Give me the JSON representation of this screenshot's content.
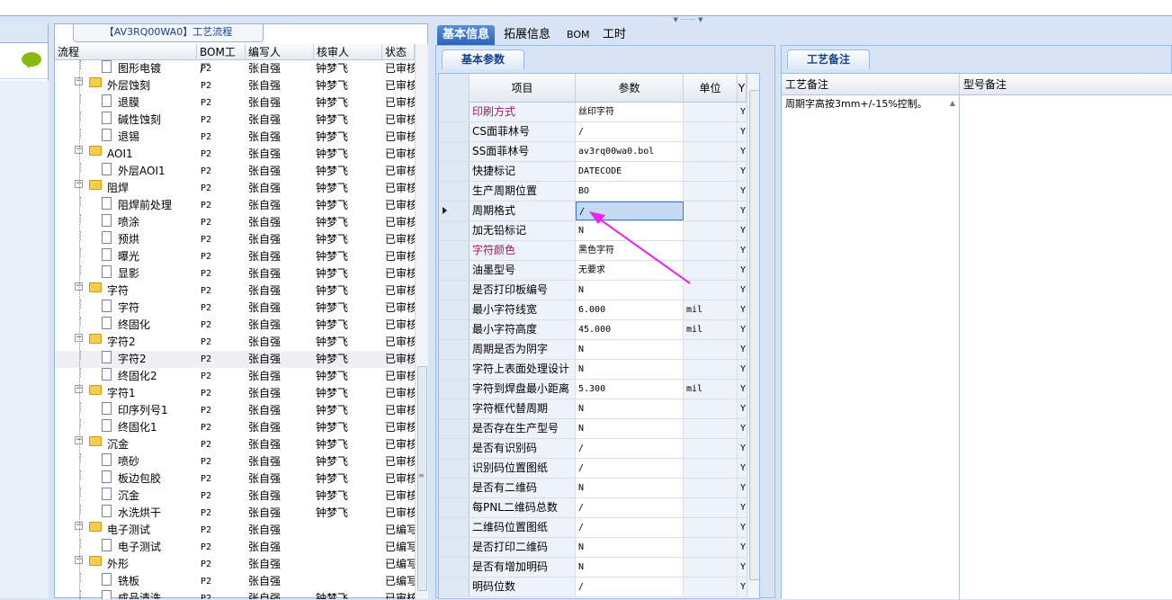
{
  "tree": {
    "title": "【AV3RQ00WA0】工艺流程",
    "columns": [
      "流程",
      "BOM工厂",
      "编写人",
      "核审人",
      "状态"
    ],
    "rows": [
      {
        "depth": 2,
        "type": "doc",
        "name": "图形电镀",
        "bom": "P2",
        "writer": "张自强",
        "reviewer": "钟梦飞",
        "status": "已审核"
      },
      {
        "depth": 1,
        "type": "folder",
        "name": "外层蚀刻",
        "bom": "P2",
        "writer": "张自强",
        "reviewer": "钟梦飞",
        "status": "已审核"
      },
      {
        "depth": 2,
        "type": "doc",
        "name": "退膜",
        "bom": "P2",
        "writer": "张自强",
        "reviewer": "钟梦飞",
        "status": "已审核"
      },
      {
        "depth": 2,
        "type": "doc",
        "name": "碱性蚀刻",
        "bom": "P2",
        "writer": "张自强",
        "reviewer": "钟梦飞",
        "status": "已审核"
      },
      {
        "depth": 2,
        "type": "doc",
        "name": "退锡",
        "bom": "P2",
        "writer": "张自强",
        "reviewer": "钟梦飞",
        "status": "已审核"
      },
      {
        "depth": 1,
        "type": "folder",
        "name": "AOI1",
        "bom": "P2",
        "writer": "张自强",
        "reviewer": "钟梦飞",
        "status": "已审核"
      },
      {
        "depth": 2,
        "type": "doc",
        "name": "外层AOI1",
        "bom": "P2",
        "writer": "张自强",
        "reviewer": "钟梦飞",
        "status": "已审核"
      },
      {
        "depth": 1,
        "type": "folder",
        "name": "阻焊",
        "bom": "P2",
        "writer": "张自强",
        "reviewer": "钟梦飞",
        "status": "已审核"
      },
      {
        "depth": 2,
        "type": "doc",
        "name": "阻焊前处理",
        "bom": "P2",
        "writer": "张自强",
        "reviewer": "钟梦飞",
        "status": "已审核"
      },
      {
        "depth": 2,
        "type": "doc",
        "name": "喷涂",
        "bom": "P2",
        "writer": "张自强",
        "reviewer": "钟梦飞",
        "status": "已审核"
      },
      {
        "depth": 2,
        "type": "doc",
        "name": "预烘",
        "bom": "P2",
        "writer": "张自强",
        "reviewer": "钟梦飞",
        "status": "已审核"
      },
      {
        "depth": 2,
        "type": "doc",
        "name": "曝光",
        "bom": "P2",
        "writer": "张自强",
        "reviewer": "钟梦飞",
        "status": "已审核"
      },
      {
        "depth": 2,
        "type": "doc",
        "name": "显影",
        "bom": "P2",
        "writer": "张自强",
        "reviewer": "钟梦飞",
        "status": "已审核"
      },
      {
        "depth": 1,
        "type": "folder",
        "name": "字符",
        "bom": "P2",
        "writer": "张自强",
        "reviewer": "钟梦飞",
        "status": "已审核"
      },
      {
        "depth": 2,
        "type": "doc",
        "name": "字符",
        "bom": "P2",
        "writer": "张自强",
        "reviewer": "钟梦飞",
        "status": "已审核"
      },
      {
        "depth": 2,
        "type": "doc",
        "name": "终固化",
        "bom": "P2",
        "writer": "张自强",
        "reviewer": "钟梦飞",
        "status": "已审核"
      },
      {
        "depth": 1,
        "type": "folder",
        "name": "字符2",
        "bom": "P2",
        "writer": "张自强",
        "reviewer": "钟梦飞",
        "status": "已审核"
      },
      {
        "depth": 2,
        "type": "doc",
        "name": "字符2",
        "bom": "P2",
        "writer": "张自强",
        "reviewer": "钟梦飞",
        "status": "已审核",
        "selected": true
      },
      {
        "depth": 2,
        "type": "doc",
        "name": "终固化2",
        "bom": "P2",
        "writer": "张自强",
        "reviewer": "钟梦飞",
        "status": "已审核"
      },
      {
        "depth": 1,
        "type": "folder",
        "name": "字符1",
        "bom": "P2",
        "writer": "张自强",
        "reviewer": "钟梦飞",
        "status": "已审核"
      },
      {
        "depth": 2,
        "type": "doc",
        "name": "印序列号1",
        "bom": "P2",
        "writer": "张自强",
        "reviewer": "钟梦飞",
        "status": "已审核"
      },
      {
        "depth": 2,
        "type": "doc",
        "name": "终固化1",
        "bom": "P2",
        "writer": "张自强",
        "reviewer": "钟梦飞",
        "status": "已审核"
      },
      {
        "depth": 1,
        "type": "folder",
        "name": "沉金",
        "bom": "P2",
        "writer": "张自强",
        "reviewer": "钟梦飞",
        "status": "已审核"
      },
      {
        "depth": 2,
        "type": "doc",
        "name": "喷砂",
        "bom": "P2",
        "writer": "张自强",
        "reviewer": "钟梦飞",
        "status": "已审核"
      },
      {
        "depth": 2,
        "type": "doc",
        "name": "板边包胶",
        "bom": "P2",
        "writer": "张自强",
        "reviewer": "钟梦飞",
        "status": "已审核"
      },
      {
        "depth": 2,
        "type": "doc",
        "name": "沉金",
        "bom": "P2",
        "writer": "张自强",
        "reviewer": "钟梦飞",
        "status": "已审核"
      },
      {
        "depth": 2,
        "type": "doc",
        "name": "水洗烘干",
        "bom": "P2",
        "writer": "张自强",
        "reviewer": "钟梦飞",
        "status": "已审核"
      },
      {
        "depth": 1,
        "type": "folder",
        "name": "电子测试",
        "bom": "P2",
        "writer": "张自强",
        "reviewer": "",
        "status": "已编写"
      },
      {
        "depth": 2,
        "type": "doc",
        "name": "电子测试",
        "bom": "P2",
        "writer": "张自强",
        "reviewer": "",
        "status": "已编写"
      },
      {
        "depth": 1,
        "type": "folder",
        "name": "外形",
        "bom": "P2",
        "writer": "张自强",
        "reviewer": "",
        "status": "已编写"
      },
      {
        "depth": 2,
        "type": "doc",
        "name": "铣板",
        "bom": "P2",
        "writer": "张自强",
        "reviewer": "",
        "status": "已编写"
      },
      {
        "depth": 2,
        "type": "doc",
        "name": "成品清洗",
        "bom": "P2",
        "writer": "张自强",
        "reviewer": "钟梦飞",
        "status": "已审核"
      }
    ]
  },
  "tabs": [
    "基本信息",
    "拓展信息",
    "BOM",
    "工时"
  ],
  "basic": {
    "tab_label": "基本参数",
    "columns": [
      "项目",
      "参数",
      "单位",
      "Y"
    ],
    "rows": [
      {
        "item": "印刷方式",
        "param": "丝印字符",
        "unit": "",
        "y": "Y",
        "highlight": true
      },
      {
        "item": "CS面菲林号",
        "param": "/",
        "unit": "",
        "y": "Y"
      },
      {
        "item": "SS面菲林号",
        "param": "av3rq00wa0.bol",
        "unit": "",
        "y": "Y"
      },
      {
        "item": "快捷标记",
        "param": "DATECODE",
        "unit": "",
        "y": "Y"
      },
      {
        "item": "生产周期位置",
        "param": "BO",
        "unit": "",
        "y": "Y"
      },
      {
        "item": "周期格式",
        "param": "/",
        "unit": "",
        "y": "Y",
        "selected": true
      },
      {
        "item": "加无铅标记",
        "param": "N",
        "unit": "",
        "y": "Y"
      },
      {
        "item": "字符颜色",
        "param": "黑色字符",
        "unit": "",
        "y": "Y",
        "highlight": true
      },
      {
        "item": "油墨型号",
        "param": "无要求",
        "unit": "",
        "y": "Y"
      },
      {
        "item": "是否打印板编号",
        "param": "N",
        "unit": "",
        "y": "Y"
      },
      {
        "item": "最小字符线宽",
        "param": "6.000",
        "unit": "mil",
        "y": "Y"
      },
      {
        "item": "最小字符高度",
        "param": "45.000",
        "unit": "mil",
        "y": "Y"
      },
      {
        "item": "周期是否为阴字",
        "param": "N",
        "unit": "",
        "y": "Y"
      },
      {
        "item": "字符上表面处理设计",
        "param": "N",
        "unit": "",
        "y": "Y"
      },
      {
        "item": "字符到焊盘最小距离",
        "param": "5.300",
        "unit": "mil",
        "y": "Y"
      },
      {
        "item": "字符框代替周期",
        "param": "N",
        "unit": "",
        "y": "Y"
      },
      {
        "item": "是否存在生产型号",
        "param": "N",
        "unit": "",
        "y": "Y"
      },
      {
        "item": "是否有识别码",
        "param": "/",
        "unit": "",
        "y": "Y"
      },
      {
        "item": "识别码位置图纸",
        "param": "/",
        "unit": "",
        "y": "Y"
      },
      {
        "item": "是否有二维码",
        "param": "N",
        "unit": "",
        "y": "Y"
      },
      {
        "item": "每PNL二维码总数",
        "param": "/",
        "unit": "",
        "y": "Y"
      },
      {
        "item": "二维码位置图纸",
        "param": "/",
        "unit": "",
        "y": "Y"
      },
      {
        "item": "是否打印二维码",
        "param": "N",
        "unit": "",
        "y": "Y"
      },
      {
        "item": "是否有增加明码",
        "param": "N",
        "unit": "",
        "y": "Y"
      },
      {
        "item": "明码位数",
        "param": "/",
        "unit": "",
        "y": "Y"
      }
    ]
  },
  "remarks": {
    "tab_label": "工艺备注",
    "col_process": "工艺备注",
    "col_model": "型号备注",
    "process_note": "周期字高按3mm+/-15%控制。"
  },
  "colors": {
    "highlight_item": "#9b1a6b",
    "annotation_arrow": "#ee22ee",
    "tab_active": "#2c64b8"
  }
}
